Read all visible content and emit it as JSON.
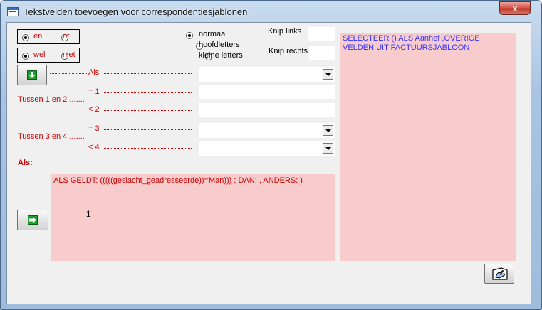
{
  "window": {
    "title": "Tekstvelden toevoegen voor correspondentiesjablonen",
    "close_label": "x"
  },
  "options": {
    "en_label": "en",
    "of_label": "of",
    "wel_label": "wel",
    "niet_label": "niet",
    "case_options": [
      "normaal",
      "hoofdletters",
      "kleine letters"
    ],
    "knip_links_label": "Knip links",
    "knip_links_value": "",
    "knip_rechts_label": "Knip rechts",
    "knip_rechts_value": ""
  },
  "conditions": {
    "als_label": "Als",
    "tussen12_label": "Tussen 1 en 2 .......",
    "eq1_label": "= 1",
    "lt2_label": "< 2",
    "tussen34_label": "Tussen 3 en 4 .......",
    "eq3_label": "= 3",
    "lt4_label": "< 4",
    "als_value": "",
    "eq1_value": "",
    "lt2_value": "",
    "eq3_value": "",
    "lt4_value": ""
  },
  "result": {
    "heading": "Als:",
    "text": "ALS GELDT: (((((geslacht_geadresseerde))=Man))) ; DAN:  , ANDERS: )",
    "callout_number": "1"
  },
  "right_panel": {
    "text": "SELECTEER () ALS Aanhef ,OVERIGE VELDEN UIT FACTUURSJABLOON"
  },
  "colors": {
    "label_red": "#cc0000",
    "panel_pink": "#f8cccc",
    "panel_text_blue": "#3333ff"
  }
}
